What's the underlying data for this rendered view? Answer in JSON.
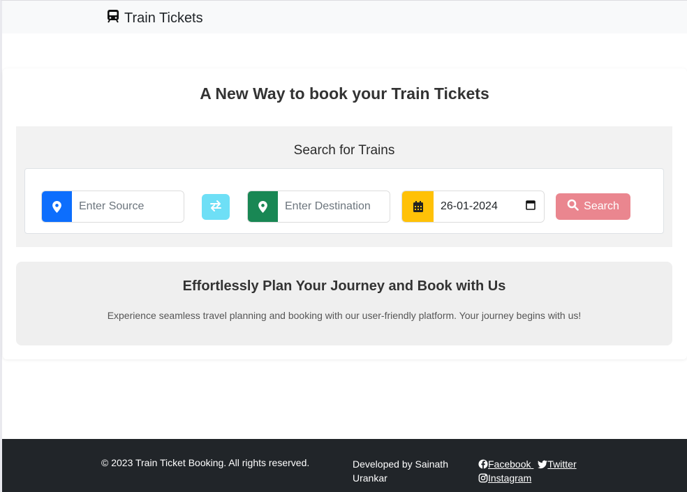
{
  "navbar": {
    "brand_icon": "train-icon",
    "brand_label": "Train Tickets"
  },
  "main": {
    "title": "A New Way to book your Train Tickets",
    "search": {
      "title": "Search for Trains",
      "source": {
        "icon": "map-pin-icon",
        "placeholder": "Enter Source",
        "value": "",
        "color": "#0d6efd"
      },
      "swap": {
        "icon": "swap-arrows-icon",
        "color": "#6edff6"
      },
      "destination": {
        "icon": "map-pin-icon",
        "placeholder": "Enter Destination",
        "value": "",
        "color": "#198754"
      },
      "date": {
        "icon": "calendar-icon",
        "value": "26-01-2024",
        "color": "#ffc107"
      },
      "search_button": {
        "icon": "search-icon",
        "label": "Search",
        "color": "#ea868f"
      }
    },
    "info": {
      "title": "Effortlessly Plan Your Journey and Book with Us",
      "text": "Experience seamless travel planning and booking with our user-friendly platform. Your journey begins with us!"
    }
  },
  "footer": {
    "copyright": "© 2023 Train Ticket Booking. All rights reserved.",
    "developer": "Developed by Sainath Urankar",
    "social": [
      {
        "icon": "facebook-icon",
        "label": "Facebook"
      },
      {
        "icon": "twitter-icon",
        "label": "Twitter"
      },
      {
        "icon": "instagram-icon",
        "label": "Instagram"
      }
    ]
  }
}
